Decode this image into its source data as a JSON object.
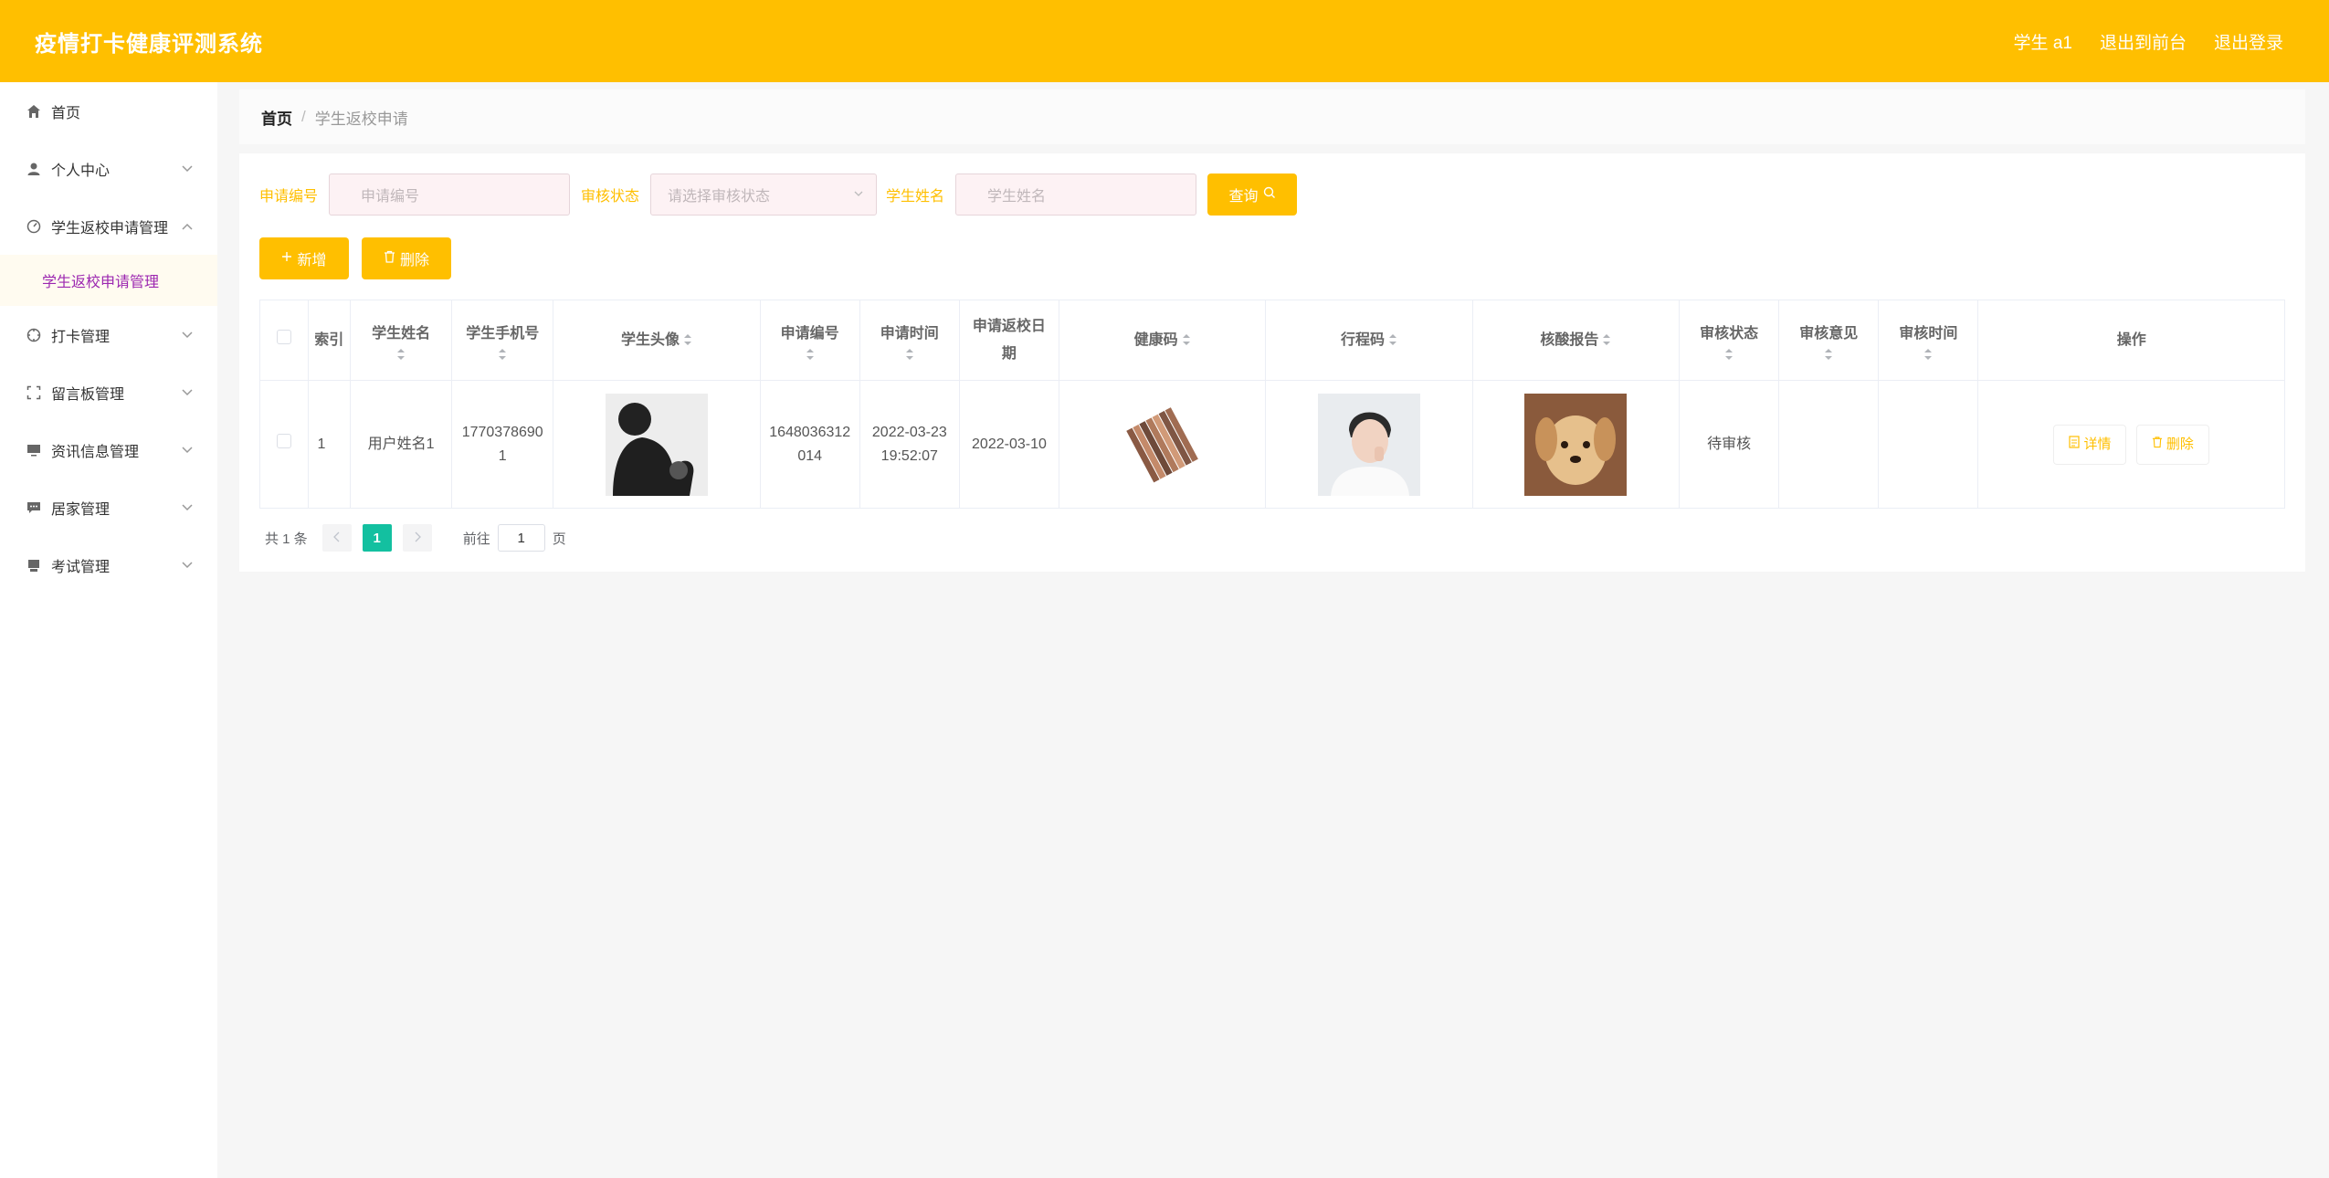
{
  "header": {
    "title": "疫情打卡健康评测系统",
    "user": "学生 a1",
    "to_front": "退出到前台",
    "logout": "退出登录"
  },
  "sidebar": {
    "items": [
      {
        "label": "首页",
        "icon": "home-icon"
      },
      {
        "label": "个人中心",
        "icon": "user-icon"
      },
      {
        "label": "学生返校申请管理",
        "icon": "dashboard-icon",
        "sub": "学生返校申请管理"
      },
      {
        "label": "打卡管理",
        "icon": "clock-icon"
      },
      {
        "label": "留言板管理",
        "icon": "fullscreen-icon"
      },
      {
        "label": "资讯信息管理",
        "icon": "monitor-icon"
      },
      {
        "label": "居家管理",
        "icon": "chat-icon"
      },
      {
        "label": "考试管理",
        "icon": "printer-icon"
      }
    ]
  },
  "breadcrumb": {
    "home": "首页",
    "sep": "/",
    "current": "学生返校申请"
  },
  "search": {
    "app_no_label": "申请编号",
    "app_no_placeholder": "申请编号",
    "status_label": "审核状态",
    "status_placeholder": "请选择审核状态",
    "name_label": "学生姓名",
    "name_placeholder": "学生姓名",
    "query_button": "查询"
  },
  "actions": {
    "add": "新增",
    "delete": "删除"
  },
  "table": {
    "headers": [
      "索引",
      "学生姓名",
      "学生手机号",
      "学生头像",
      "申请编号",
      "申请时间",
      "申请返校日期",
      "健康码",
      "行程码",
      "核酸报告",
      "审核状态",
      "审核意见",
      "审核时间",
      "操作"
    ],
    "rows": [
      {
        "index": "1",
        "name": "用户姓名1",
        "phone": "17703786901",
        "app_no": "1648036312014",
        "app_time": "2022-03-23 19:52:07",
        "return_date": "2022-03-10",
        "status": "待审核",
        "opinion": "",
        "review_time": "",
        "detail_button": "详情",
        "delete_button": "删除"
      }
    ]
  },
  "pagination": {
    "total": "共 1 条",
    "current": "1",
    "goto": "前往",
    "page_input": "1",
    "page_unit": "页"
  },
  "colors": {
    "accent": "#ffbf00",
    "pager_active": "#13c0a0",
    "submenu_text": "#9c27b0"
  }
}
